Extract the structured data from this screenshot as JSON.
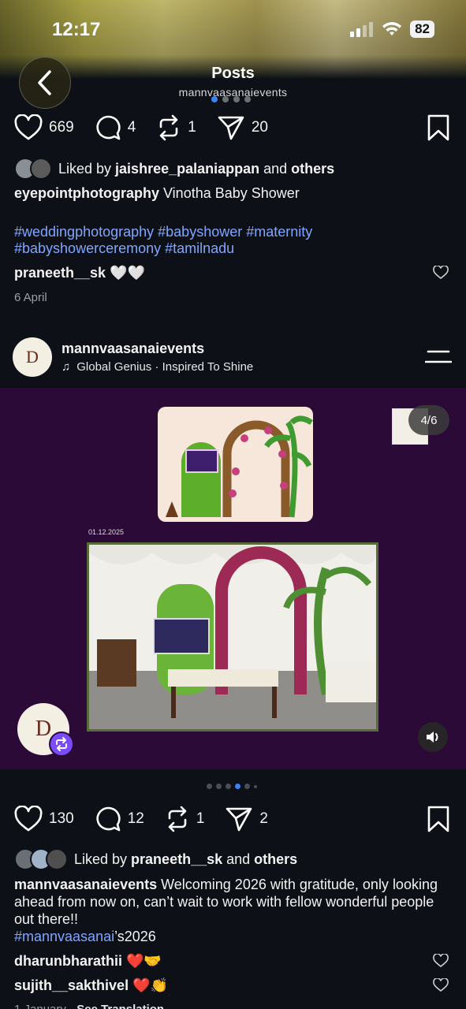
{
  "status": {
    "time": "12:17",
    "battery": "82"
  },
  "header": {
    "title": "Posts",
    "subtitle": "mannvaasanaievents"
  },
  "post1": {
    "likes": "669",
    "comments": "4",
    "reposts": "1",
    "shares": "20",
    "liked_by_prefix": "Liked by ",
    "liked_by_user": "jaishree_palaniappan",
    "liked_by_and": " and ",
    "liked_by_others": "others",
    "caption_user": "eyepointphotography",
    "caption_text": " Vinotha Baby Shower",
    "hashtags_line1": "#weddingphotography #babyshower #maternity",
    "hashtags_line2": "#babyshowerceremony #tamilnadu",
    "comment_user": "praneeth__sk",
    "comment_text": " 🤍🤍",
    "date": "6 April"
  },
  "post2": {
    "username": "mannvaasanaievents",
    "song": "Global Genius · Inspired To Shine",
    "counter": "4/6",
    "image_date": "01.12.2025",
    "logo_letter": "D",
    "likes": "130",
    "comments": "12",
    "reposts": "1",
    "shares": "2",
    "liked_by_prefix": "Liked by ",
    "liked_by_user": "praneeth__sk",
    "liked_by_and": " and ",
    "liked_by_others": "others",
    "caption_user": "mannvaasanaievents",
    "caption_text": " Welcoming 2026 with gratitude, only looking ahead from now on, can’t wait to work with fellow wonderful people out there!!",
    "caption_tag": "#mannvaasanai",
    "caption_tag_suffix": "’s2026",
    "comments_list": [
      {
        "user": "dharunbharathii",
        "text": " ❤️🤝"
      },
      {
        "user": "sujith__sakthivel",
        "text": " ❤️👏"
      }
    ],
    "footer_date": "1 January",
    "footer_sep": " · ",
    "see_translation": "See Translation"
  }
}
